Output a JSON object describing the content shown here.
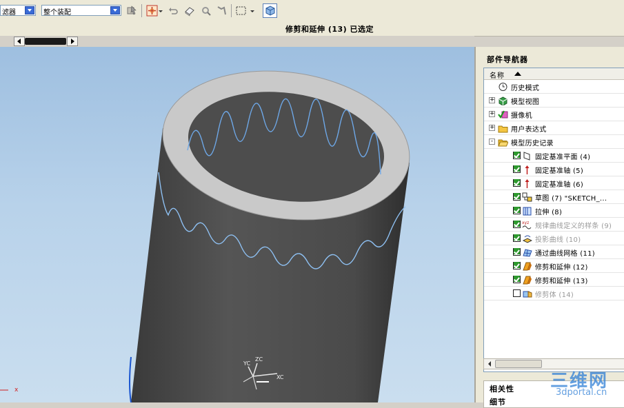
{
  "toolbar": {
    "filter_combo": "滤器",
    "scope_combo": "整个装配"
  },
  "status": {
    "message": "修剪和延伸 (13) 已选定"
  },
  "viewport": {
    "axis_labels": {
      "xc": "XC",
      "yc": "YC",
      "zc": "ZC"
    },
    "origin_mark": "x"
  },
  "navigator": {
    "title": "部件导航器",
    "column_name": "名称",
    "items": [
      {
        "label": "历史模式",
        "level": 0,
        "icon": "clock-icon",
        "expander": "",
        "checked": null,
        "dim": false
      },
      {
        "label": "模型视图",
        "level": 0,
        "icon": "model-view-icon",
        "expander": "+",
        "checked": null,
        "dim": false
      },
      {
        "label": "摄像机",
        "level": 0,
        "icon": "camera-icon",
        "expander": "+",
        "checked": null,
        "dim": false
      },
      {
        "label": "用户表达式",
        "level": 0,
        "icon": "folder-icon",
        "expander": "+",
        "checked": null,
        "dim": false
      },
      {
        "label": "模型历史记录",
        "level": 0,
        "icon": "folder-open-icon",
        "expander": "-",
        "checked": null,
        "dim": false
      },
      {
        "label": "固定基准平面 (4)",
        "level": 1,
        "icon": "datum-plane-icon",
        "checked": true,
        "dim": false
      },
      {
        "label": "固定基准轴 (5)",
        "level": 1,
        "icon": "datum-axis-icon",
        "checked": true,
        "dim": false
      },
      {
        "label": "固定基准轴 (6)",
        "level": 1,
        "icon": "datum-axis-icon",
        "checked": true,
        "dim": false
      },
      {
        "label": "草图 (7) \"SKETCH_...",
        "level": 1,
        "icon": "sketch-icon",
        "checked": true,
        "dim": false
      },
      {
        "label": "拉伸 (8)",
        "level": 1,
        "icon": "extrude-icon",
        "checked": true,
        "dim": false
      },
      {
        "label": "规律曲线定义的样条 (9)",
        "level": 1,
        "icon": "law-curve-icon",
        "checked": true,
        "dim": true
      },
      {
        "label": "投影曲线 (10)",
        "level": 1,
        "icon": "project-curve-icon",
        "checked": true,
        "dim": true
      },
      {
        "label": "通过曲线网格 (11)",
        "level": 1,
        "icon": "curve-mesh-icon",
        "checked": true,
        "dim": false
      },
      {
        "label": "修剪和延伸 (12)",
        "level": 1,
        "icon": "trim-extend-icon",
        "checked": true,
        "dim": false
      },
      {
        "label": "修剪和延伸 (13)",
        "level": 1,
        "icon": "trim-extend-icon",
        "checked": true,
        "dim": false
      },
      {
        "label": "修剪体 (14)",
        "level": 1,
        "icon": "trim-body-icon",
        "checked": false,
        "dim": true
      }
    ],
    "relations_title": "相关性",
    "details_title": "细节"
  },
  "watermark": {
    "main": "三维网",
    "sub": "3dportal.cn"
  },
  "colors": {
    "viewport_top": "#9ebfe0",
    "viewport_bottom": "#cadeef",
    "cylinder_body": "#4a4a4a",
    "cylinder_rim": "#c8c8c8",
    "wave_edge": "#6ea8e8",
    "check_green": "#2e9a2e"
  }
}
